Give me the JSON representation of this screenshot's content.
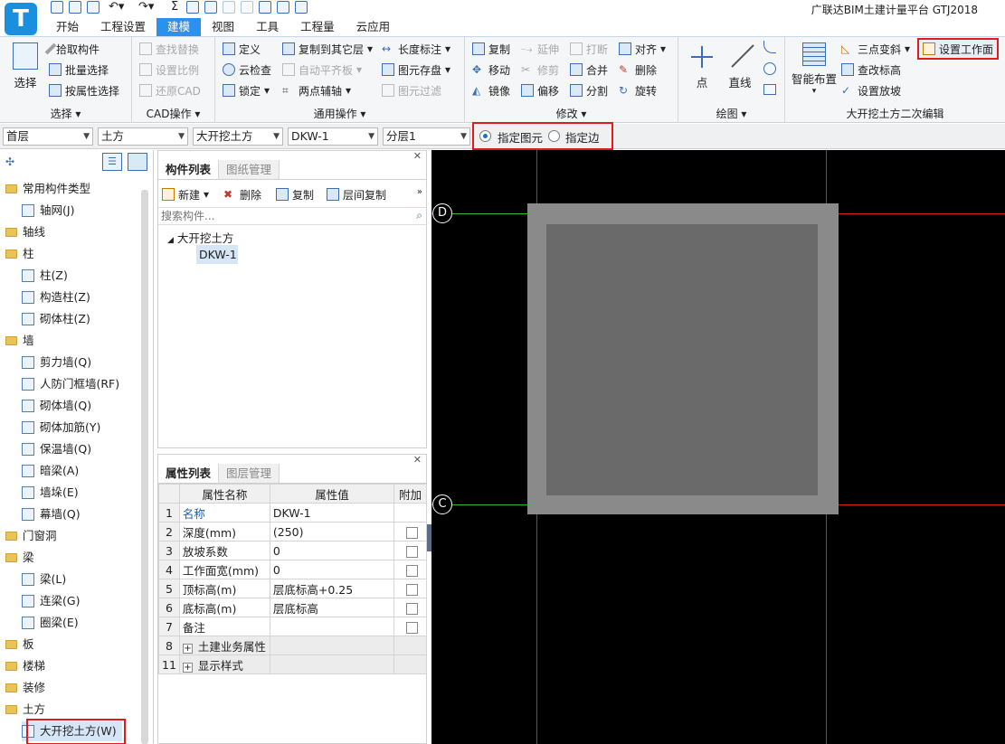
{
  "app": {
    "logo": "T",
    "title": "广联达BIM土建计量平台 GTJ2018"
  },
  "menu_tabs": [
    "开始",
    "工程设置",
    "建模",
    "视图",
    "工具",
    "工程量",
    "云应用"
  ],
  "active_tab": "建模",
  "ribbon": {
    "select_group": {
      "label": "选择",
      "big": "选择",
      "items": [
        "拾取构件",
        "批量选择",
        "按属性选择"
      ]
    },
    "cad_group": {
      "label": "CAD操作",
      "items": [
        "查找替换",
        "设置比例",
        "还原CAD"
      ]
    },
    "common_group": {
      "label": "通用操作",
      "items": [
        "定义",
        "云检查",
        "锁定",
        "复制到其它层",
        "自动平齐板",
        "两点辅轴",
        "长度标注",
        "图元存盘",
        "图元过滤"
      ]
    },
    "modify_group": {
      "label": "修改",
      "items": [
        "复制",
        "移动",
        "镜像",
        "延伸",
        "修剪",
        "偏移",
        "打断",
        "合并",
        "分割",
        "对齐",
        "删除",
        "旋转"
      ]
    },
    "draw_group": {
      "label": "绘图",
      "items": [
        "点",
        "直线"
      ]
    },
    "excavation_group": {
      "label": "大开挖土方二次编辑",
      "big": "智能布置",
      "items": [
        "三点变斜",
        "查改标高",
        "设置放坡",
        "设置工作面"
      ]
    }
  },
  "filterbar": {
    "floor": "首层",
    "category": "土方",
    "type": "大开挖土方",
    "component": "DKW-1",
    "layer": "分层1",
    "radio1": "指定图元",
    "radio2": "指定边"
  },
  "tree": {
    "items": [
      {
        "label": "常用构件类型",
        "folder": true
      },
      {
        "label": "轴网(J)",
        "folder": false
      },
      {
        "label": "轴线",
        "folder": true
      },
      {
        "label": "柱",
        "folder": true
      },
      {
        "label": "柱(Z)",
        "folder": false
      },
      {
        "label": "构造柱(Z)",
        "folder": false
      },
      {
        "label": "砌体柱(Z)",
        "folder": false
      },
      {
        "label": "墙",
        "folder": true
      },
      {
        "label": "剪力墙(Q)",
        "folder": false
      },
      {
        "label": "人防门框墙(RF)",
        "folder": false
      },
      {
        "label": "砌体墙(Q)",
        "folder": false
      },
      {
        "label": "砌体加筋(Y)",
        "folder": false
      },
      {
        "label": "保温墙(Q)",
        "folder": false
      },
      {
        "label": "暗梁(A)",
        "folder": false
      },
      {
        "label": "墙垛(E)",
        "folder": false
      },
      {
        "label": "幕墙(Q)",
        "folder": false
      },
      {
        "label": "门窗洞",
        "folder": true
      },
      {
        "label": "梁",
        "folder": true
      },
      {
        "label": "梁(L)",
        "folder": false
      },
      {
        "label": "连梁(G)",
        "folder": false
      },
      {
        "label": "圈梁(E)",
        "folder": false
      },
      {
        "label": "板",
        "folder": true
      },
      {
        "label": "楼梯",
        "folder": true
      },
      {
        "label": "装修",
        "folder": true
      },
      {
        "label": "土方",
        "folder": true
      },
      {
        "label": "大开挖土方(W)",
        "folder": false
      }
    ]
  },
  "component_panel": {
    "tabs": [
      "构件列表",
      "图纸管理"
    ],
    "actions": [
      "新建",
      "删除",
      "复制",
      "层间复制"
    ],
    "search_placeholder": "搜索构件...",
    "root": "大开挖土方",
    "child": "DKW-1"
  },
  "property_panel": {
    "tabs": [
      "属性列表",
      "图层管理"
    ],
    "headers": [
      "属性名称",
      "属性值",
      "附加"
    ],
    "rows": [
      {
        "no": "1",
        "name": "名称",
        "value": "DKW-1",
        "check": false
      },
      {
        "no": "2",
        "name": "深度(mm)",
        "value": "(250)",
        "check": true
      },
      {
        "no": "3",
        "name": "放坡系数",
        "value": "0",
        "check": true
      },
      {
        "no": "4",
        "name": "工作面宽(mm)",
        "value": "0",
        "check": true
      },
      {
        "no": "5",
        "name": "顶标高(m)",
        "value": "层底标高+0.25",
        "check": true
      },
      {
        "no": "6",
        "name": "底标高(m)",
        "value": "层底标高",
        "check": true
      },
      {
        "no": "7",
        "name": "备注",
        "value": "",
        "check": true
      },
      {
        "no": "8",
        "name": "土建业务属性",
        "value": "",
        "check": false,
        "group": true
      },
      {
        "no": "11",
        "name": "显示样式",
        "value": "",
        "check": false,
        "group": true
      }
    ]
  },
  "canvas": {
    "axis_top": "D",
    "axis_bottom": "C",
    "bg": "#000000",
    "grid_color": "#e01b1b",
    "axis_line_color": "#2fb82f"
  }
}
